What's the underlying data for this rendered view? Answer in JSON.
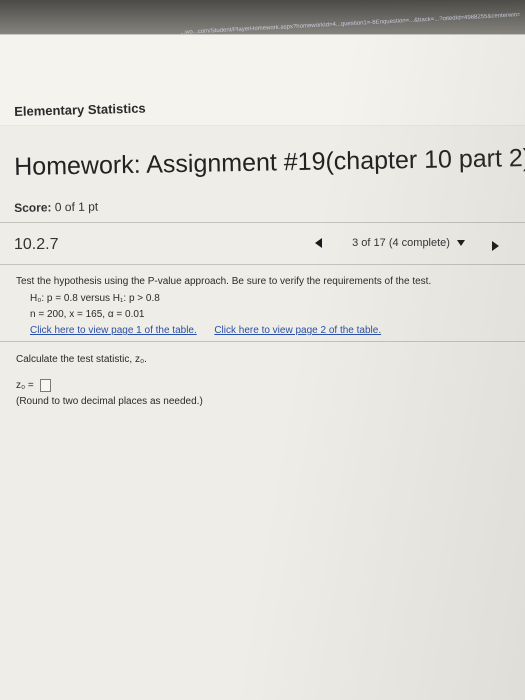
{
  "browser": {
    "url_fragment": "...wo...com/Student/PlayerHomework.aspx?homeworkId=4...question1=-8Enquestion=...&back=...?oitedId=4988255&centerwin=yes"
  },
  "header": {
    "course": "Elementary Statistics"
  },
  "homework": {
    "title": "Homework: Assignment #19(chapter 10 part 2)",
    "score_label": "Score:",
    "score_value": "0 of 1 pt"
  },
  "question": {
    "number": "10.2.7",
    "nav_text": "3 of 17 (4 complete)",
    "instruction": "Test the hypothesis using the P-value approach. Be sure to verify the requirements of the test.",
    "hypotheses": "H₀: p = 0.8 versus H₁: p > 0.8",
    "givens": "n = 200, x = 165, α = 0.01",
    "link1": "Click here to view page 1 of the table.",
    "link2": "Click here to view page 2 of the table.",
    "prompt": "Calculate the test statistic, z₀.",
    "answer_label": "z₀ =",
    "round_note": "(Round to two decimal places as needed.)"
  }
}
